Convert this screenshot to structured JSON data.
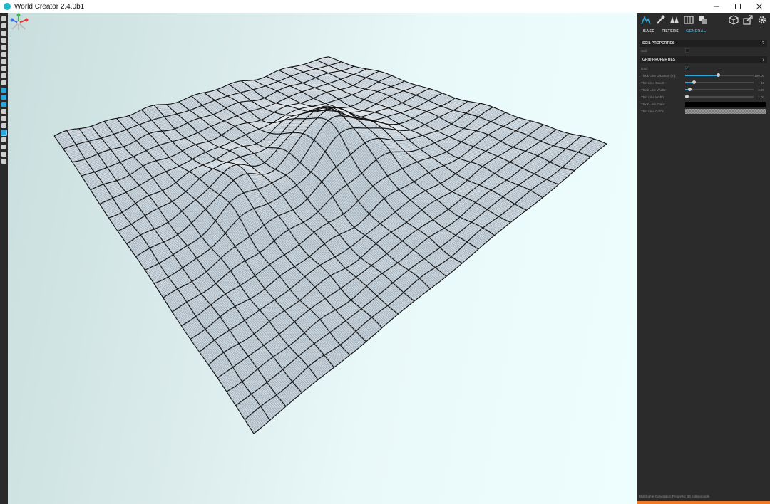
{
  "window": {
    "title": "World Creator 2.4.0b1",
    "controls": [
      "minimize",
      "maximize",
      "close"
    ]
  },
  "left_toolbar": {
    "icons": [
      "new-file-icon",
      "open-folder-icon",
      "open-recent-icon",
      "save-icon",
      "save-as-icon",
      "settings-icon",
      "map-icon",
      "layers-icon",
      "globe-icon",
      "terrain-icon",
      "brush-icon",
      "water-icon",
      "vegetation-icon",
      "path-icon",
      "image-icon",
      "tools-icon",
      "grid-icon",
      "photo-icon",
      "sphere-icon",
      "star-icon",
      "wand-icon"
    ]
  },
  "panel": {
    "top_icons_left": [
      "terrain-tool-icon",
      "brush-tool-icon",
      "trees-tool-icon",
      "map-tool-icon",
      "layers-tool-icon"
    ],
    "top_icons_right": [
      "cube-icon",
      "export-icon",
      "gear-icon"
    ],
    "tabs": [
      {
        "label": "BASE",
        "active": false
      },
      {
        "label": "FILTERS",
        "active": false
      },
      {
        "label": "GENERAL",
        "active": true
      }
    ],
    "soil": {
      "header": "SOIL PROPERTIES",
      "help": "?",
      "soil_label": "Soil:",
      "soil_checked": false
    },
    "grid": {
      "header": "GRID PROPERTIES",
      "help": "?",
      "grid_label": "Grid:",
      "grid_checked": true,
      "thick_distance_label": "Thick Line Distance (m):",
      "thick_distance_value": "100.00",
      "thick_distance_fraction": 0.48,
      "thin_count_label": "Thin Line Count:",
      "thin_count_value": "10",
      "thin_count_fraction": 0.12,
      "thick_width_label": "Thick Line Width:",
      "thick_width_value": "3.00",
      "thick_width_fraction": 0.06,
      "thin_width_label": "Thin Line Width:",
      "thin_width_value": "1.00",
      "thin_width_fraction": 0.02,
      "thick_color_label": "Thick Line Color:",
      "thick_color": "#000000",
      "thin_color_label": "Thin Line Color:"
    },
    "status": "Multiframe Generation Progress: 36 milliseconds",
    "progress_fraction": 1.0,
    "accent_color": "#2ba7e0",
    "progress_color": "#f07a26"
  }
}
